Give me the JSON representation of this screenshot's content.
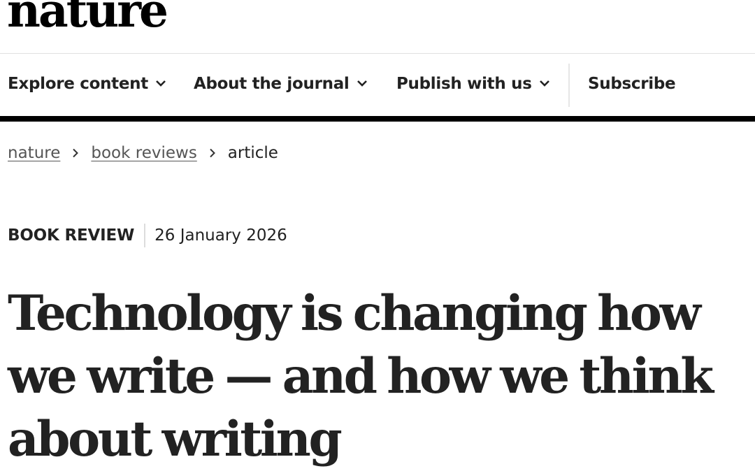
{
  "site": {
    "logo_text": "nature"
  },
  "nav": {
    "items": [
      {
        "label": "Explore content",
        "icon": "chevron-down-icon"
      },
      {
        "label": "About the journal",
        "icon": "chevron-down-icon"
      },
      {
        "label": "Publish with us",
        "icon": "chevron-down-icon"
      },
      {
        "label": "Subscribe"
      }
    ]
  },
  "breadcrumb": {
    "items": [
      {
        "label": "nature",
        "link": true
      },
      {
        "label": "book reviews",
        "link": true
      },
      {
        "label": "article",
        "link": false
      }
    ],
    "separator_icon": "chevron-right-icon"
  },
  "article": {
    "type": "BOOK REVIEW",
    "date": "26 January 2026",
    "title": "Technology is changing how we write — and how we think about writing"
  },
  "colors": {
    "text": "#222222",
    "link_muted": "#555555",
    "rule_dark": "#000000",
    "rule_light": "#e0e0e0"
  }
}
